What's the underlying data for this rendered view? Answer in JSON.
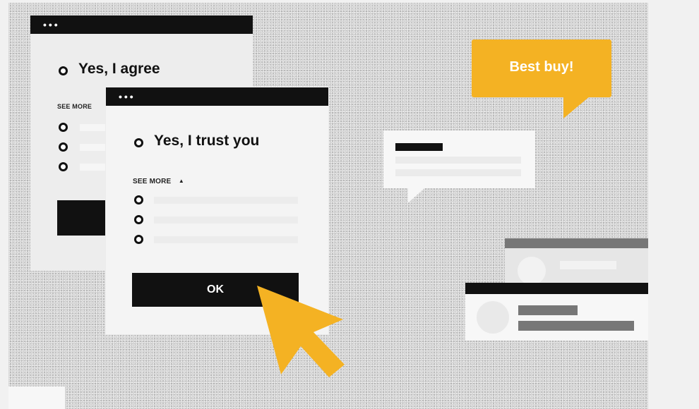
{
  "window_back": {
    "dots": "•••",
    "headline": "Yes, I agree",
    "see_more": "SEE MORE"
  },
  "window_front": {
    "dots": "•••",
    "headline": "Yes, I trust you",
    "see_more": "SEE MORE",
    "see_more_arrow": "▲",
    "ok_label": "OK"
  },
  "speech_bubble": {
    "text": "Best buy!"
  },
  "colors": {
    "accent_yellow": "#f4b223",
    "black": "#111111",
    "light_gray": "#f4f4f4",
    "mid_gray": "#777777"
  },
  "icons": {
    "cursor": "pointer-arrow-icon",
    "radio": "radio-ring-icon"
  }
}
